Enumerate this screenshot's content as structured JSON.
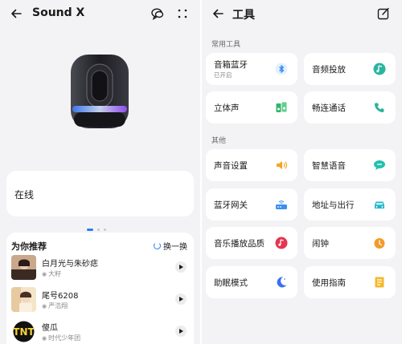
{
  "left": {
    "title": "Sound X",
    "status": "在线",
    "recommend": {
      "title": "为你推荐",
      "refresh_label": "换一换",
      "songs": [
        {
          "name": "白月光与朱砂痣",
          "artist": "大籽"
        },
        {
          "name": "尾号6208",
          "artist": "严浩翔"
        },
        {
          "name": "傻瓜",
          "artist": "时代少年团"
        }
      ]
    },
    "pager": {
      "count": 3,
      "active": 1
    }
  },
  "right": {
    "title": "工具",
    "sections": [
      {
        "title": "常用工具",
        "tiles": [
          {
            "label": "音箱蓝牙",
            "sub": "已开启",
            "icon": "bluetooth-icon",
            "color": "#2e86f0"
          },
          {
            "label": "音频投放",
            "sub": "",
            "icon": "music-cast-icon",
            "color": "#2bb5a0"
          },
          {
            "label": "立体声",
            "sub": "",
            "icon": "stereo-icon",
            "color": "#33b56b"
          },
          {
            "label": "畅连通话",
            "sub": "",
            "icon": "phone-icon",
            "color": "#29b39a"
          }
        ]
      },
      {
        "title": "其他",
        "tiles": [
          {
            "label": "声音设置",
            "sub": "",
            "icon": "volume-icon",
            "color": "#f4a623"
          },
          {
            "label": "智慧语音",
            "sub": "",
            "icon": "voice-assistant-icon",
            "color": "#23c0b0"
          },
          {
            "label": "蓝牙网关",
            "sub": "",
            "icon": "router-icon",
            "color": "#3a8ff0"
          },
          {
            "label": "地址与出行",
            "sub": "",
            "icon": "car-icon",
            "color": "#20b5c8"
          },
          {
            "label": "音乐播放品质",
            "sub": "",
            "icon": "music-quality-icon",
            "color": "#e8344e"
          },
          {
            "label": "闹钟",
            "sub": "",
            "icon": "alarm-icon",
            "color": "#f49a2a"
          },
          {
            "label": "助眠模式",
            "sub": "",
            "icon": "moon-icon",
            "color": "#3a6ff0"
          },
          {
            "label": "使用指南",
            "sub": "",
            "icon": "guide-icon",
            "color": "#f4b82a"
          }
        ]
      }
    ]
  }
}
